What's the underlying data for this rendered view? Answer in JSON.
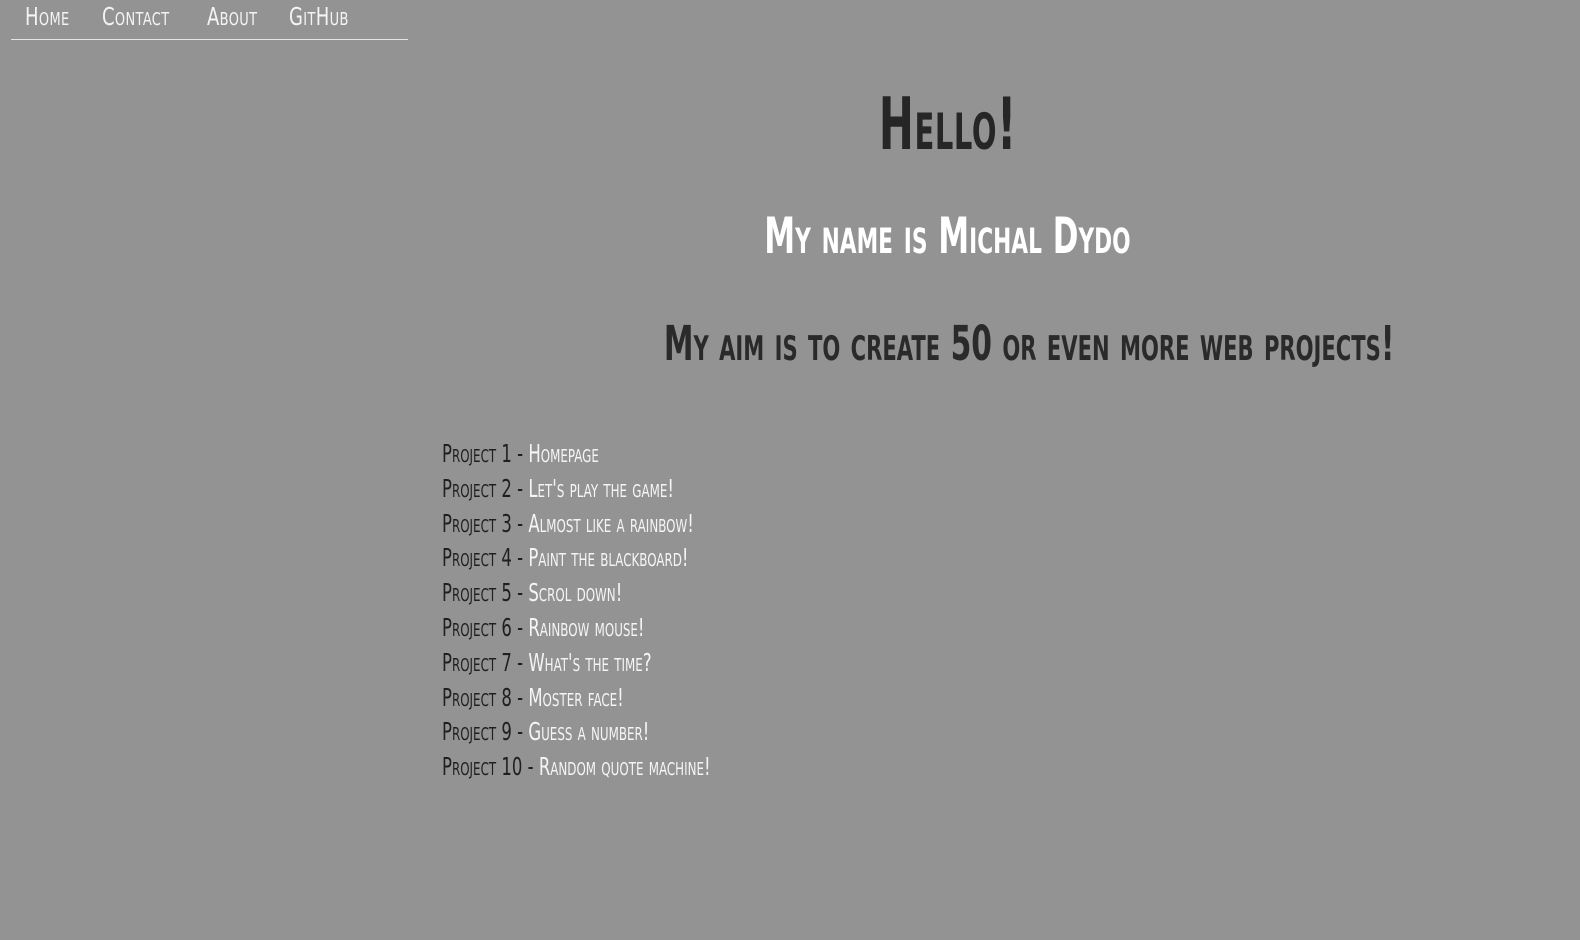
{
  "nav": {
    "items": [
      {
        "label": "Home"
      },
      {
        "label": "Contact"
      },
      {
        "label": "About"
      },
      {
        "label": "GitHub"
      }
    ]
  },
  "main": {
    "greeting": "Hello!",
    "name_line": "My name is Michal Dydo",
    "aim_line": "My aim is to create 50 or even more web projects!"
  },
  "projects": [
    {
      "number": "Project 1",
      "separator": "-",
      "title": "Homepage"
    },
    {
      "number": "Project 2",
      "separator": "-",
      "title": "Let's play the game!"
    },
    {
      "number": "Project 3",
      "separator": "-",
      "title": "Almost like a rainbow!"
    },
    {
      "number": "Project 4",
      "separator": "-",
      "title": "Paint the blackboard!"
    },
    {
      "number": "Project 5",
      "separator": "-",
      "title": "Scrol down!"
    },
    {
      "number": "Project 6",
      "separator": "-",
      "title": "Rainbow mouse!"
    },
    {
      "number": "Project 7",
      "separator": "-",
      "title": "What's the time?"
    },
    {
      "number": "Project 8",
      "separator": "-",
      "title": "Moster face!"
    },
    {
      "number": "Project 9",
      "separator": "-",
      "title": "Guess a number!"
    },
    {
      "number": "Project 10",
      "separator": "-",
      "title": "Random quote machine!"
    }
  ],
  "colors": {
    "background": "#939393",
    "dark_text": "#262626",
    "light_text": "#ffffff"
  }
}
